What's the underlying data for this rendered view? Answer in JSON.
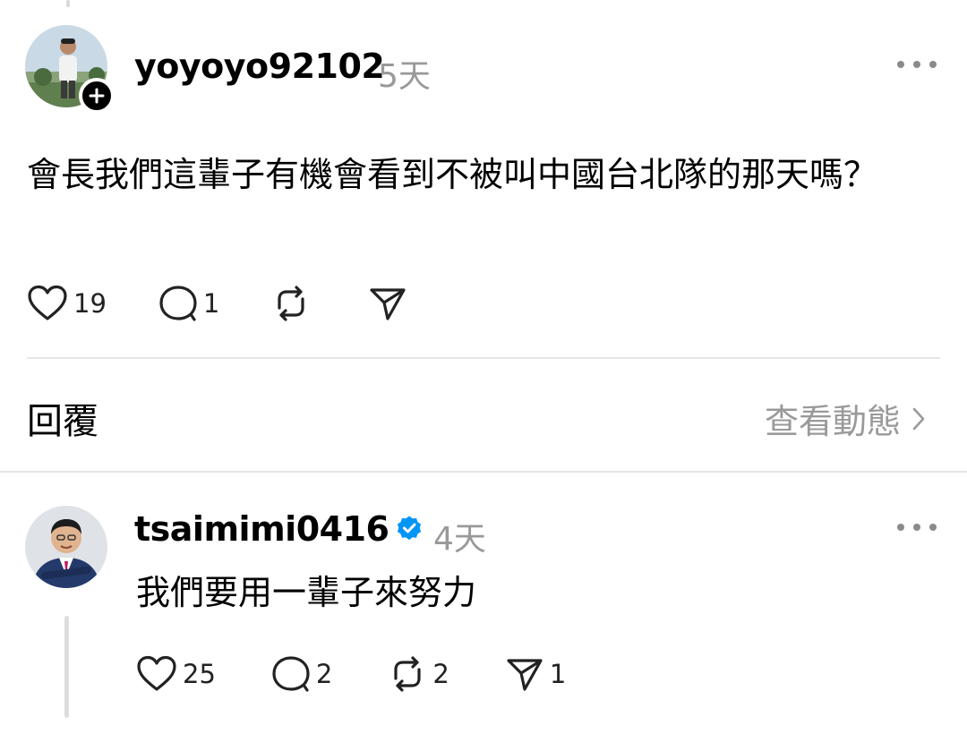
{
  "post": {
    "username": "yoyoyo92102",
    "time": "5天",
    "text": "會長我們這輩子有機會看到不被叫中國台北隊的那天嗎？",
    "actions": {
      "likes": "19",
      "comments": "1",
      "reposts": "",
      "shares": ""
    }
  },
  "replies_header": {
    "label": "回覆",
    "view_activity": "查看動態"
  },
  "reply": {
    "username": "tsaimimi0416",
    "time": "4天",
    "text": "我們要用一輩子來努力",
    "verified": true,
    "actions": {
      "likes": "25",
      "comments": "2",
      "reposts": "2",
      "shares": "1"
    }
  },
  "colors": {
    "verified_badge": "#0095f6",
    "muted_text": "#999999",
    "divider": "#e6e6e6"
  }
}
